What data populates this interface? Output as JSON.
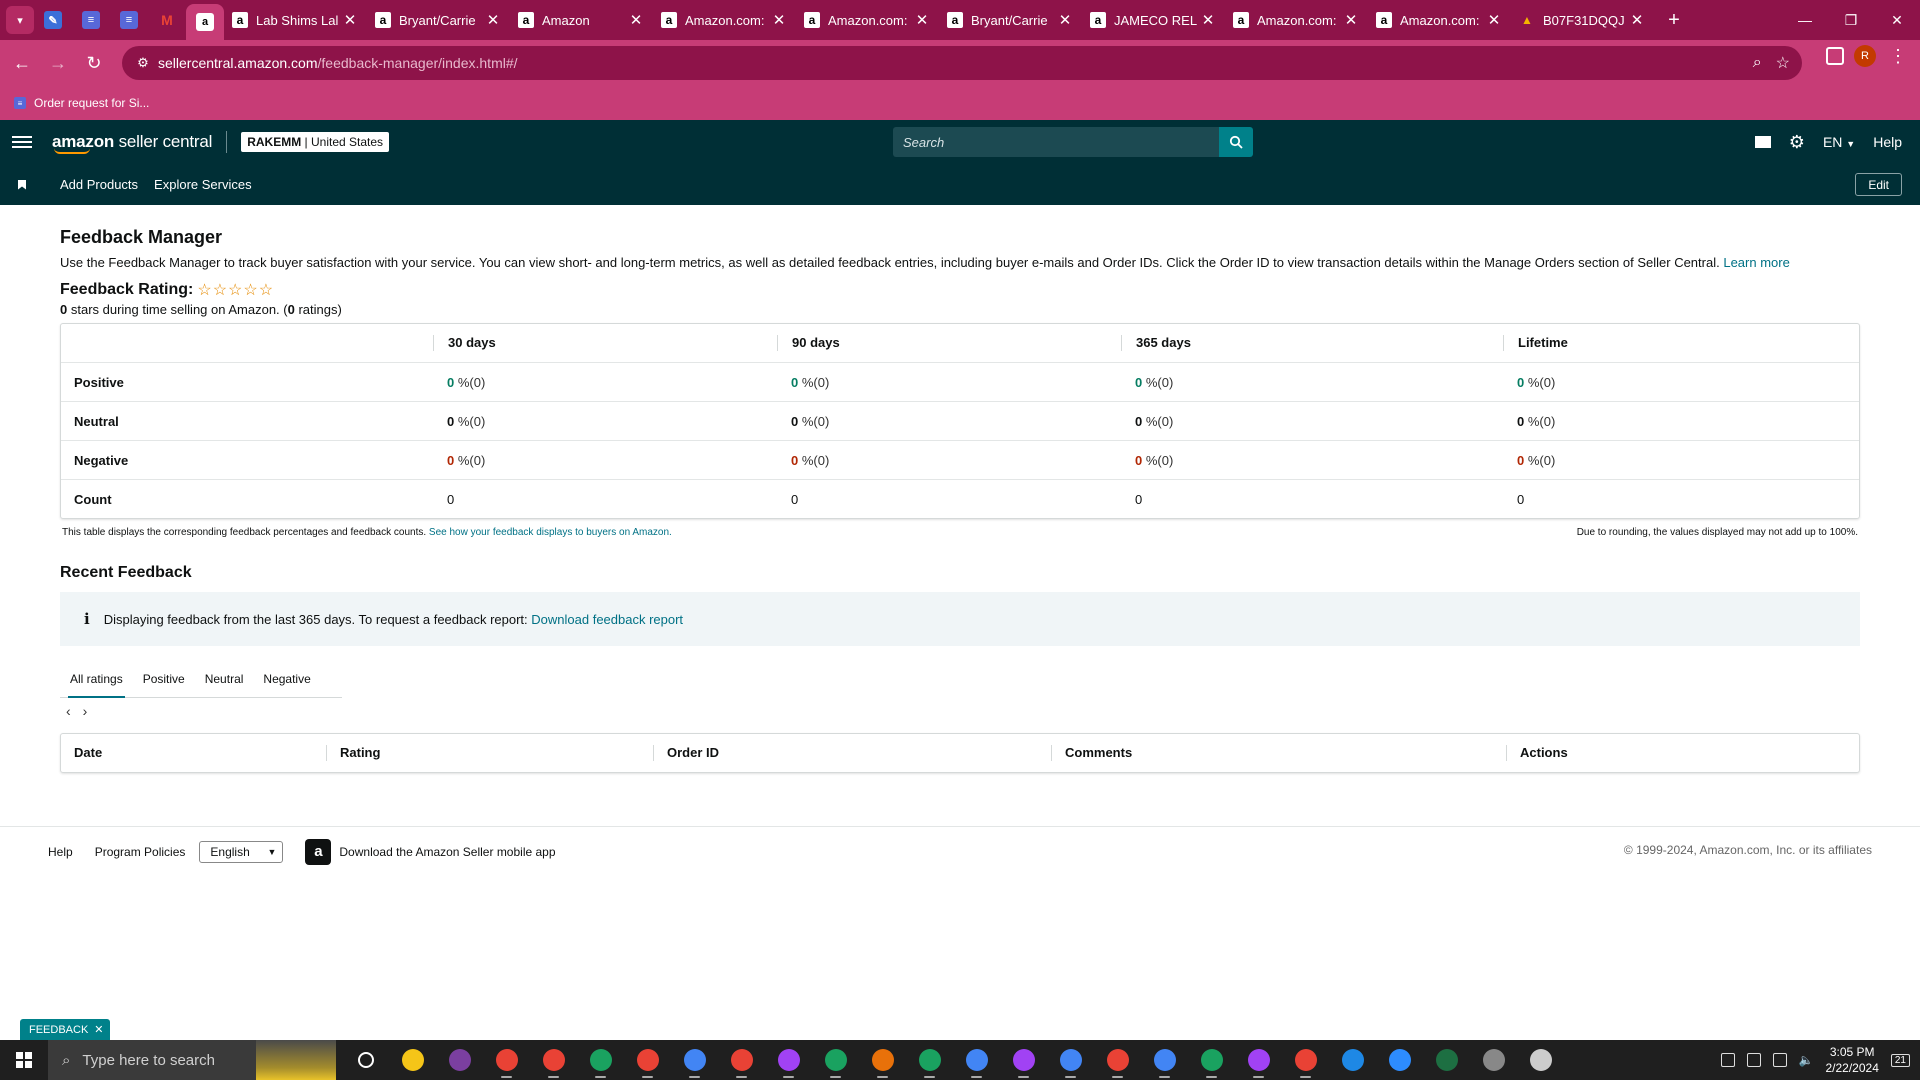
{
  "browser": {
    "tabs": [
      {
        "title": "Lab Shims Lal",
        "favicon": "amazon-a"
      },
      {
        "title": "Bryant/Carrie",
        "favicon": "amazon-a"
      },
      {
        "title": "Amazon",
        "favicon": "amazon-a"
      },
      {
        "title": "Amazon.com:",
        "favicon": "amazon-a"
      },
      {
        "title": "Amazon.com:",
        "favicon": "amazon-a"
      },
      {
        "title": "Bryant/Carrie",
        "favicon": "amazon-a"
      },
      {
        "title": "JAMECO REL",
        "favicon": "amazon-a"
      },
      {
        "title": "Amazon.com:",
        "favicon": "amazon-a"
      },
      {
        "title": "Amazon.com:",
        "favicon": "amazon-a"
      },
      {
        "title": "B07F31DQQJ",
        "favicon": "drive"
      }
    ],
    "url_host": "sellercentral.amazon.com",
    "url_path": "/feedback-manager/index.html#/",
    "profile_initial": "R",
    "bookmark": "Order request for Si..."
  },
  "header": {
    "logo_bold": "amazon",
    "logo_rest": " seller central",
    "account_store": "RAKEMM",
    "account_region": "United States",
    "search_placeholder": "Search",
    "language": "EN",
    "help": "Help"
  },
  "subnav": {
    "add_products": "Add Products",
    "explore_services": "Explore Services",
    "edit": "Edit"
  },
  "page": {
    "title": "Feedback Manager",
    "description": "Use the Feedback Manager to track buyer satisfaction with your service. You can view short- and long-term metrics, as well as detailed feedback entries, including buyer e-mails and Order IDs. Click the Order ID to view transaction details within the Manage Orders section of Seller Central.",
    "learn_more": "Learn more",
    "rating_label": "Feedback Rating:",
    "stars": "☆☆☆☆☆",
    "stars_value": "0",
    "stars_text": " stars during time selling on Amazon. (",
    "ratings_count": "0",
    "ratings_suffix": " ratings)"
  },
  "feedback_table": {
    "columns": [
      "",
      "30 days",
      "90 days",
      "365 days",
      "Lifetime"
    ],
    "rows": {
      "positive": {
        "label": "Positive",
        "cells": [
          "0",
          "0",
          "0",
          "0"
        ],
        "suffix": " %(0)"
      },
      "neutral": {
        "label": "Neutral",
        "cells": [
          "0",
          "0",
          "0",
          "0"
        ],
        "suffix": " %(0)"
      },
      "negative": {
        "label": "Negative",
        "cells": [
          "0",
          "0",
          "0",
          "0"
        ],
        "suffix": " %(0)"
      },
      "count": {
        "label": "Count",
        "cells": [
          "0",
          "0",
          "0",
          "0"
        ]
      }
    },
    "note_left": "This table displays the corresponding feedback percentages and feedback counts.",
    "note_link": "See how your feedback displays to buyers on Amazon.",
    "note_right": "Due to rounding, the values displayed may not add up to 100%."
  },
  "recent": {
    "title": "Recent Feedback",
    "info_text": "Displaying feedback from the last 365 days. To request a feedback report:",
    "info_link": "Download feedback report",
    "tabs": [
      "All ratings",
      "Positive",
      "Neutral",
      "Negative"
    ],
    "active_tab": "All ratings",
    "columns": [
      "Date",
      "Rating",
      "Order ID",
      "Comments",
      "Actions"
    ]
  },
  "footer": {
    "help": "Help",
    "program_policies": "Program Policies",
    "language": "English",
    "app_text": "Download the Amazon Seller mobile app",
    "copyright": "© 1999-2024, Amazon.com, Inc. or its affiliates"
  },
  "feedback_tag": "FEEDBACK",
  "taskbar": {
    "search_placeholder": "Type here to search",
    "time": "3:05 PM",
    "date": "2/22/2024",
    "notification_count": "21"
  },
  "colors": {
    "tabbar": "#8e1349",
    "addressbar": "#c73c76",
    "seller_header": "#002f36",
    "link": "#007185",
    "positive": "#067d62",
    "negative": "#b12704"
  }
}
